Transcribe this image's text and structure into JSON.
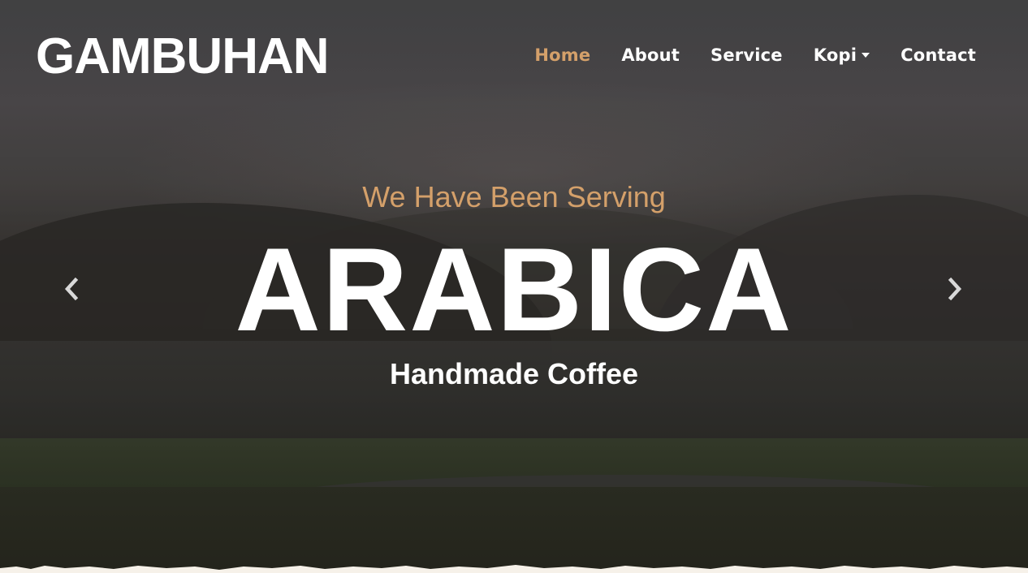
{
  "brand": {
    "name": "GAMBUHAN"
  },
  "nav": {
    "items": [
      {
        "label": "Home",
        "active": true
      },
      {
        "label": "About"
      },
      {
        "label": "Service"
      },
      {
        "label": "Kopi",
        "dropdown": true
      },
      {
        "label": "Contact"
      }
    ]
  },
  "hero": {
    "subtitle": "We Have Been Serving",
    "headline": "ARABICA",
    "tagline": "Handmade Coffee",
    "prev_icon": "chevron-left-icon",
    "next_icon": "chevron-right-icon"
  },
  "colors": {
    "accent": "#d4a06a",
    "text": "#ffffff"
  }
}
